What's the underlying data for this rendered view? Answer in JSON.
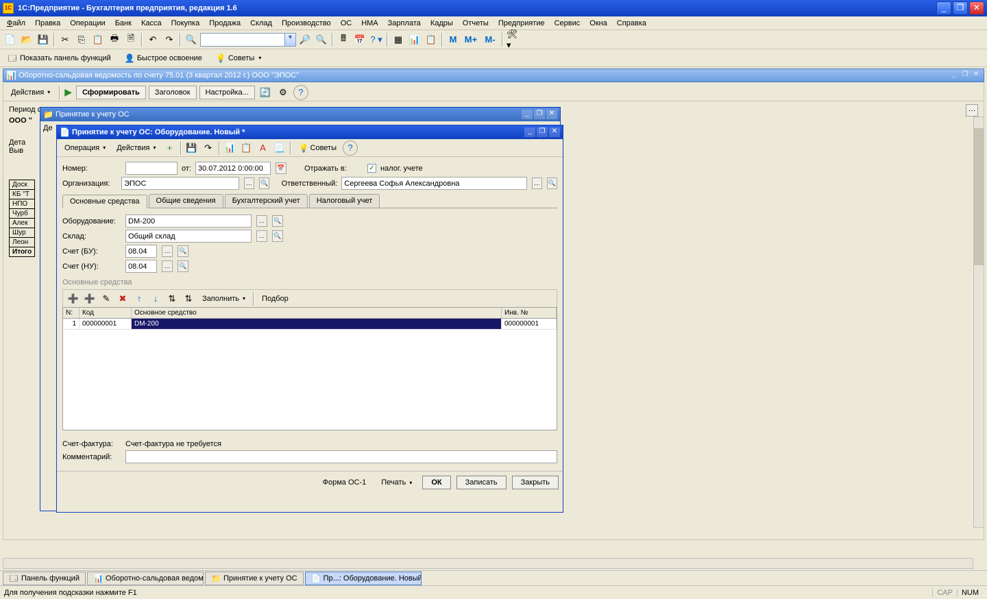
{
  "app": {
    "title": "1С:Предприятие - Бухгалтерия предприятия, редакция 1.6"
  },
  "menu": [
    "Файл",
    "Правка",
    "Операции",
    "Банк",
    "Касса",
    "Покупка",
    "Продажа",
    "Склад",
    "Производство",
    "ОС",
    "НМА",
    "Зарплата",
    "Кадры",
    "Отчеты",
    "Предприятие",
    "Сервис",
    "Окна",
    "Справка"
  ],
  "toolbar2": {
    "show_panel": "Показать панель функций",
    "quick": "Быстрое освоение",
    "tips": "Советы"
  },
  "mcodes": {
    "m": "М",
    "mplus": "М+",
    "mminus": "М-"
  },
  "mdi": {
    "title": "Оборотно-сальдовая ведомость по счету 75.01 (3 квартал 2012 г.) ООО \"ЭПОС\""
  },
  "repbar": {
    "actions": "Действия",
    "form": "Сформировать",
    "header": "Заголовок",
    "settings": "Настройка..."
  },
  "repbody": {
    "period": "Период с",
    "org_lbl": "ООО \"",
    "det": "Дета",
    "vyv": "Выв",
    "actions": "Де",
    "rows": [
      "Доск",
      "КБ \"Т",
      "НПО",
      "Чурб",
      "Алек",
      "Шур",
      "Леон",
      "Итого"
    ]
  },
  "win1": {
    "title": "Принятие к учету ОС"
  },
  "win2": {
    "title": "Принятие к учету ОС: Оборудование. Новый *",
    "tb": {
      "op": "Операция",
      "act": "Действия",
      "tips": "Советы"
    },
    "fields": {
      "number_lbl": "Номер:",
      "number": "",
      "from": "от:",
      "date": "30.07.2012 0:00:00",
      "reflect_lbl": "Отражать в:",
      "tax": "налог. учете",
      "org_lbl": "Организация:",
      "org": "ЭПОС",
      "resp_lbl": "Ответственный:",
      "resp": "Сергеева Софья Александровна",
      "equip_lbl": "Оборудование:",
      "equip": "DM-200",
      "wh_lbl": "Склад:",
      "wh": "Общий склад",
      "acct_bu_lbl": "Счет (БУ):",
      "acct_bu": "08.04",
      "acct_nu_lbl": "Счет (НУ):",
      "acct_nu": "08.04",
      "invoice_lbl": "Счет-фактура:",
      "invoice": "Счет-фактура не требуется",
      "comment_lbl": "Комментарий:"
    },
    "tabs": [
      "Основные средства",
      "Общие сведения",
      "Бухгалтерский учет",
      "Налоговый учет"
    ],
    "section": "Основные средства",
    "grid_tb": {
      "fill": "Заполнить",
      "select": "Подбор"
    },
    "grid_cols": {
      "n": "N:",
      "code": "Код",
      "name": "Основное средство",
      "inv": "Инв. №"
    },
    "grid_row": {
      "n": "1",
      "code": "000000001",
      "name": "DM-200",
      "inv": "000000001"
    },
    "footer": {
      "form": "Форма ОС-1",
      "print": "Печать",
      "ok": "ОК",
      "save": "Записать",
      "close": "Закрыть"
    }
  },
  "taskbar": [
    {
      "label": "Панель функций"
    },
    {
      "label": "Оборотно-сальдовая ведом..."
    },
    {
      "label": "Принятие к учету ОС"
    },
    {
      "label": "Пр...: Оборудование. Новый *",
      "active": true
    }
  ],
  "status": {
    "hint": "Для получения подсказки нажмите F1",
    "cap": "CAP",
    "num": "NUM"
  }
}
